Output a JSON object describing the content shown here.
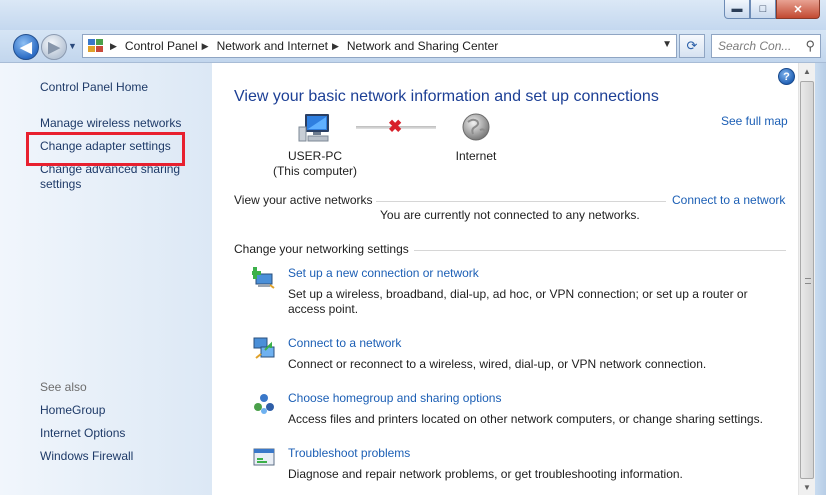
{
  "window": {
    "minimize_glyph": "▬",
    "maximize_glyph": "□",
    "close_glyph": "✕"
  },
  "navbar": {
    "back_glyph": "◀",
    "forward_glyph": "▶",
    "recent_glyph": "▼",
    "breadcrumbs": [
      "Control Panel",
      "Network and Internet",
      "Network and Sharing Center"
    ],
    "crumb_separator": "▶",
    "dropdown_glyph": "▼",
    "refresh_glyph": "⟳",
    "search_placeholder": "Search Con...",
    "search_glyph": "⚲"
  },
  "sidebar": {
    "home_link": "Control Panel Home",
    "links": [
      "Manage wireless networks",
      "Change adapter settings",
      "Change advanced sharing settings"
    ],
    "see_also_label": "See also",
    "see_also_links": [
      "HomeGroup",
      "Internet Options",
      "Windows Firewall"
    ]
  },
  "main": {
    "help_glyph": "?",
    "title": "View your basic network information and set up connections",
    "see_full_map": "See full map",
    "computer_name": "USER-PC",
    "computer_sub": "(This computer)",
    "internet_label": "Internet",
    "disconnected_glyph": "✖",
    "active_networks_head": "View your active networks",
    "connect_to_network_link": "Connect to a network",
    "not_connected_text": "You are currently not connected to any networks.",
    "change_settings_head": "Change your networking settings",
    "tasks": [
      {
        "title": "Set up a new connection or network",
        "desc": "Set up a wireless, broadband, dial-up, ad hoc, or VPN connection; or set up a router or access point."
      },
      {
        "title": "Connect to a network",
        "desc": "Connect or reconnect to a wireless, wired, dial-up, or VPN network connection."
      },
      {
        "title": "Choose homegroup and sharing options",
        "desc": "Access files and printers located on other network computers, or change sharing settings."
      },
      {
        "title": "Troubleshoot problems",
        "desc": "Diagnose and repair network problems, or get troubleshooting information."
      }
    ]
  },
  "scrollbar": {
    "up_glyph": "▲",
    "down_glyph": "▼"
  },
  "colors": {
    "link": "#1c5fb5",
    "title": "#1c3f95",
    "highlight": "#e8202f"
  }
}
